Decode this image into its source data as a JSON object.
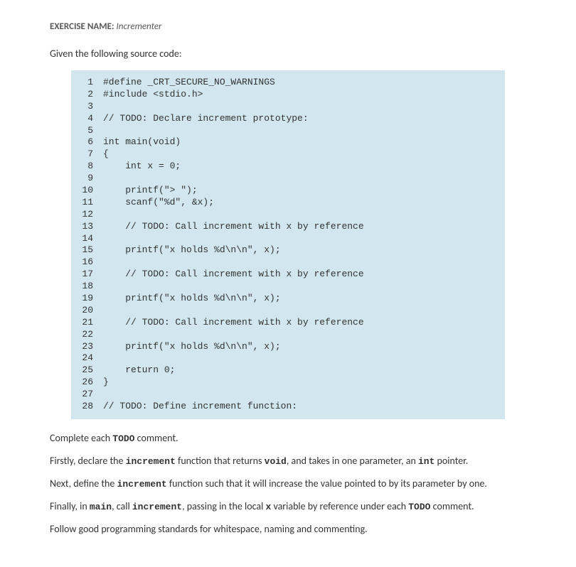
{
  "header": {
    "label": "EXERCISE NAME:",
    "name": "Incrementer"
  },
  "intro": "Given the following source code:",
  "code": {
    "lines": [
      {
        "num": "1",
        "text": "#define _CRT_SECURE_NO_WARNINGS"
      },
      {
        "num": "2",
        "text": "#include <stdio.h>"
      },
      {
        "num": "3",
        "text": ""
      },
      {
        "num": "4",
        "text": "// TODO: Declare increment prototype:"
      },
      {
        "num": "5",
        "text": ""
      },
      {
        "num": "6",
        "text": "int main(void)"
      },
      {
        "num": "7",
        "text": "{"
      },
      {
        "num": "8",
        "text": "    int x = 0;"
      },
      {
        "num": "9",
        "text": ""
      },
      {
        "num": "10",
        "text": "    printf(\"> \");"
      },
      {
        "num": "11",
        "text": "    scanf(\"%d\", &x);"
      },
      {
        "num": "12",
        "text": ""
      },
      {
        "num": "13",
        "text": "    // TODO: Call increment with x by reference"
      },
      {
        "num": "14",
        "text": ""
      },
      {
        "num": "15",
        "text": "    printf(\"x holds %d\\n\\n\", x);"
      },
      {
        "num": "16",
        "text": ""
      },
      {
        "num": "17",
        "text": "    // TODO: Call increment with x by reference"
      },
      {
        "num": "18",
        "text": ""
      },
      {
        "num": "19",
        "text": "    printf(\"x holds %d\\n\\n\", x);"
      },
      {
        "num": "20",
        "text": ""
      },
      {
        "num": "21",
        "text": "    // TODO: Call increment with x by reference"
      },
      {
        "num": "22",
        "text": ""
      },
      {
        "num": "23",
        "text": "    printf(\"x holds %d\\n\\n\", x);"
      },
      {
        "num": "24",
        "text": ""
      },
      {
        "num": "25",
        "text": "    return 0;"
      },
      {
        "num": "26",
        "text": "}"
      },
      {
        "num": "27",
        "text": ""
      },
      {
        "num": "28",
        "text": "// TODO: Define increment function:"
      }
    ]
  },
  "paragraphs": {
    "p1_a": "Complete each ",
    "p1_b": "TODO",
    "p1_c": " comment.",
    "p2_a": "Firstly, declare the ",
    "p2_b": "increment",
    "p2_c": " function that returns ",
    "p2_d": "void",
    "p2_e": ", and takes in one parameter, an ",
    "p2_f": "int",
    "p2_g": " pointer.",
    "p3_a": "Next, define the ",
    "p3_b": "increment",
    "p3_c": " function such that it will increase the value pointed to by its parameter by one.",
    "p4_a": "Finally, in ",
    "p4_b": "main",
    "p4_c": ", call ",
    "p4_d": "increment",
    "p4_e": ", passing in the local ",
    "p4_f": "x",
    "p4_g": " variable by reference under each ",
    "p4_h": "TODO",
    "p4_i": " comment.",
    "p5": "Follow good programming standards for whitespace, naming and commenting."
  }
}
